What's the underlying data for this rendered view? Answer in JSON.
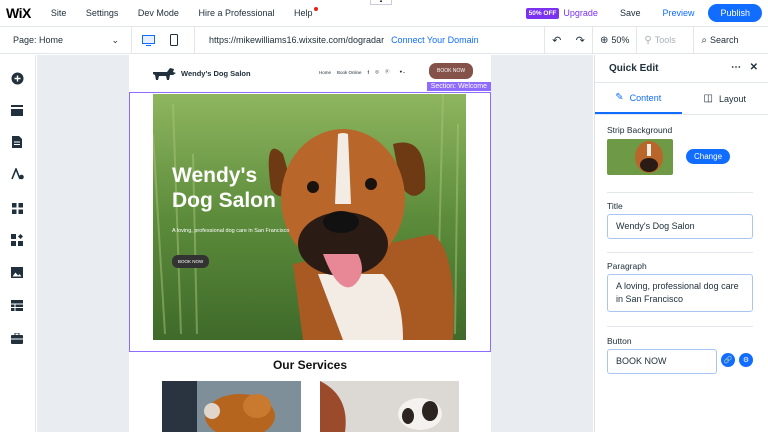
{
  "topbar": {
    "logo": "WiX",
    "menu": [
      "Site",
      "Settings",
      "Dev Mode",
      "Hire a Professional",
      "Help"
    ],
    "badge": "50% OFF",
    "upgrade": "Upgrade",
    "save": "Save",
    "preview": "Preview",
    "publish": "Publish"
  },
  "secondbar": {
    "page_label": "Page: Home",
    "url": "https://mikewilliams16.wixsite.com/dogradar",
    "connect": "Connect Your Domain",
    "zoom": "50%",
    "tools": "Tools",
    "search": "Search"
  },
  "site": {
    "name": "Wendy's Dog Salon",
    "nav_links": [
      "Home",
      "Book Online"
    ],
    "nav_button": "BOOK NOW",
    "section_label": "Section: Welcome",
    "hero_title_line1": "Wendy's",
    "hero_title_line2": "Dog Salon",
    "hero_paragraph": "A loving, professional dog care in San Francisco",
    "hero_button": "BOOK NOW",
    "services_title": "Our Services"
  },
  "panel": {
    "title": "Quick Edit",
    "tab_content": "Content",
    "tab_layout": "Layout",
    "strip_label": "Strip Background",
    "change_button": "Change",
    "title_label": "Title",
    "title_value": "Wendy's Dog Salon",
    "paragraph_label": "Paragraph",
    "paragraph_value": "A loving, professional dog care in San Francisco",
    "button_label": "Button",
    "button_value": "BOOK NOW"
  },
  "colors": {
    "accent": "#116dff",
    "upgrade": "#7a32f0",
    "selection": "#8f6cff",
    "nav_button": "#85524a"
  }
}
